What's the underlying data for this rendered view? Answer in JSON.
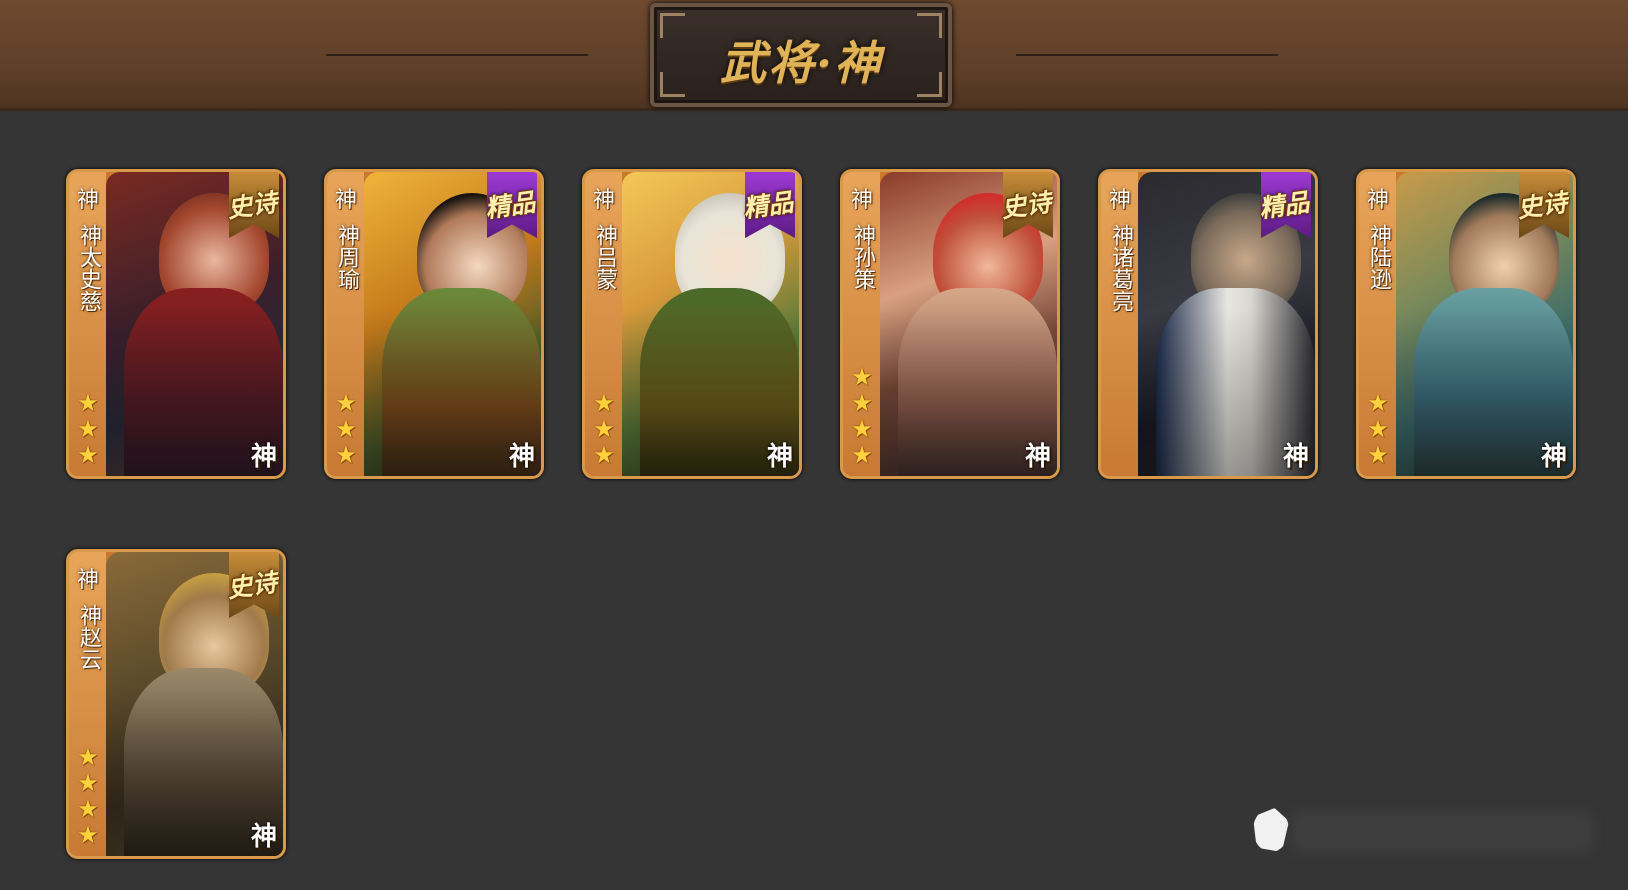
{
  "header": {
    "title": "武将·神"
  },
  "colors": {
    "background": "#353535",
    "header": "#6e4a2f",
    "card_frame": "#d89a4a",
    "epic_ribbon": "#c98e3a",
    "fine_ribbon": "#a03ad6"
  },
  "cards": [
    {
      "kind": "神",
      "name": "神太史慈",
      "stars": [
        "★",
        "★",
        "★"
      ],
      "rarity": "史诗",
      "badge": "神"
    },
    {
      "kind": "神",
      "name": "神周瑜",
      "stars": [
        "★",
        "★",
        "★"
      ],
      "rarity": "精品",
      "badge": "神"
    },
    {
      "kind": "神",
      "name": "神吕蒙",
      "stars": [
        "★",
        "★",
        "★"
      ],
      "rarity": "精品",
      "badge": "神"
    },
    {
      "kind": "神",
      "name": "神孙策",
      "stars": [
        "★",
        "★",
        "★",
        "★"
      ],
      "rarity": "史诗",
      "badge": "神"
    },
    {
      "kind": "神",
      "name": "神诸葛亮",
      "stars": [],
      "rarity": "精品",
      "badge": "神"
    },
    {
      "kind": "神",
      "name": "神陆逊",
      "stars": [
        "★",
        "★",
        "★"
      ],
      "rarity": "史诗",
      "badge": "神"
    },
    {
      "kind": "神",
      "name": "神赵云",
      "stars": [
        "★",
        "★",
        "★",
        "★"
      ],
      "rarity": "史诗",
      "badge": "神"
    }
  ]
}
